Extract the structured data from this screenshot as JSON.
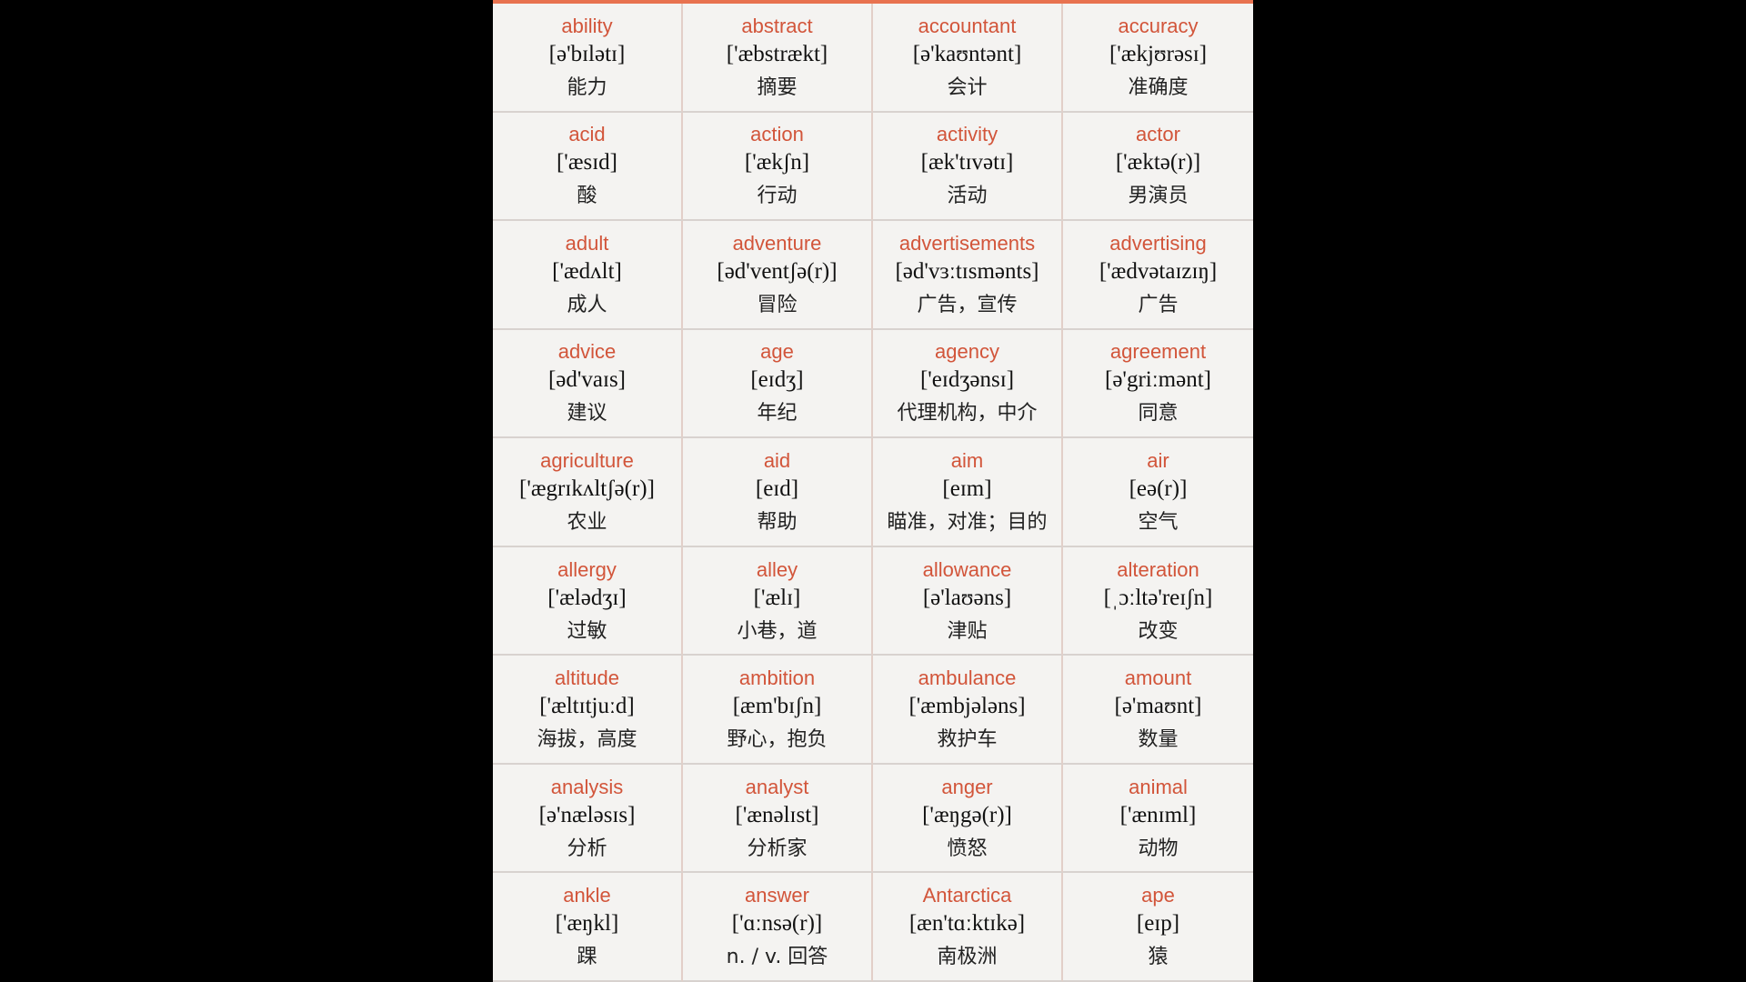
{
  "accent_color": "#d2553a",
  "entries": [
    {
      "word": "ability",
      "ipa": "[ə'bɪlətɪ]",
      "cn": "能力"
    },
    {
      "word": "abstract",
      "ipa": "['æbstrækt]",
      "cn": "摘要"
    },
    {
      "word": "accountant",
      "ipa": "[ə'kaʊntənt]",
      "cn": "会计"
    },
    {
      "word": "accuracy",
      "ipa": "['ækjʊrəsɪ]",
      "cn": "准确度"
    },
    {
      "word": "acid",
      "ipa": "['æsɪd]",
      "cn": "酸"
    },
    {
      "word": "action",
      "ipa": "['ækʃn]",
      "cn": "行动"
    },
    {
      "word": "activity",
      "ipa": "[æk'tɪvətɪ]",
      "cn": "活动"
    },
    {
      "word": "actor",
      "ipa": "['æktə(r)]",
      "cn": "男演员"
    },
    {
      "word": "adult",
      "ipa": "['ædʌlt]",
      "cn": "成人"
    },
    {
      "word": "adventure",
      "ipa": "[əd'ventʃə(r)]",
      "cn": "冒险"
    },
    {
      "word": "advertisements",
      "ipa": "[əd'vɜːtɪsmənts]",
      "cn": "广告，宣传"
    },
    {
      "word": "advertising",
      "ipa": "['ædvətaɪzɪŋ]",
      "cn": "广告"
    },
    {
      "word": "advice",
      "ipa": "[əd'vaɪs]",
      "cn": "建议"
    },
    {
      "word": "age",
      "ipa": "[eɪdʒ]",
      "cn": "年纪"
    },
    {
      "word": "agency",
      "ipa": "['eɪdʒənsɪ]",
      "cn": "代理机构，中介"
    },
    {
      "word": "agreement",
      "ipa": "[ə'griːmənt]",
      "cn": "同意"
    },
    {
      "word": "agriculture",
      "ipa": "['ægrɪkʌltʃə(r)]",
      "cn": "农业"
    },
    {
      "word": "aid",
      "ipa": "[eɪd]",
      "cn": "帮助"
    },
    {
      "word": "aim",
      "ipa": "[eɪm]",
      "cn": "瞄准，对准；目的"
    },
    {
      "word": "air",
      "ipa": "[eə(r)]",
      "cn": "空气"
    },
    {
      "word": "allergy",
      "ipa": "['ælədʒɪ]",
      "cn": "过敏"
    },
    {
      "word": "alley",
      "ipa": "['ælɪ]",
      "cn": "小巷，道"
    },
    {
      "word": "allowance",
      "ipa": "[ə'laʊəns]",
      "cn": "津贴"
    },
    {
      "word": "alteration",
      "ipa": "[ˌɔːltə'reɪʃn]",
      "cn": "改变"
    },
    {
      "word": "altitude",
      "ipa": "['æltɪtjuːd]",
      "cn": "海拔，高度"
    },
    {
      "word": "ambition",
      "ipa": "[æm'bɪʃn]",
      "cn": "野心，抱负"
    },
    {
      "word": "ambulance",
      "ipa": "['æmbjələns]",
      "cn": "救护车"
    },
    {
      "word": "amount",
      "ipa": "[ə'maʊnt]",
      "cn": "数量"
    },
    {
      "word": "analysis",
      "ipa": "[ə'næləsɪs]",
      "cn": "分析"
    },
    {
      "word": "analyst",
      "ipa": "['ænəlɪst]",
      "cn": "分析家"
    },
    {
      "word": "anger",
      "ipa": "['æŋgə(r)]",
      "cn": "愤怒"
    },
    {
      "word": "animal",
      "ipa": "['ænɪml]",
      "cn": "动物"
    },
    {
      "word": "ankle",
      "ipa": "['æŋkl]",
      "cn": "踝"
    },
    {
      "word": "answer",
      "ipa": "['ɑːnsə(r)]",
      "cn": "n. / v. 回答"
    },
    {
      "word": "Antarctica",
      "ipa": "[æn'tɑːktɪkə]",
      "cn": "南极洲"
    },
    {
      "word": "ape",
      "ipa": "[eɪp]",
      "cn": "猿"
    }
  ]
}
